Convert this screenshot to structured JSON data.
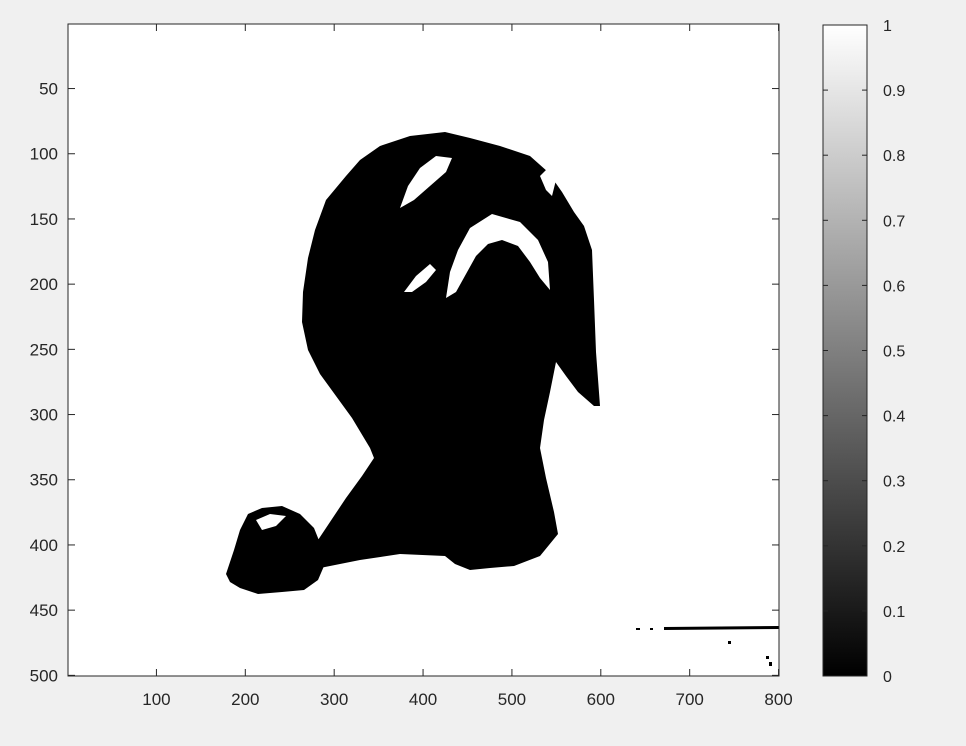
{
  "chart_data": {
    "type": "heatmap",
    "title": "",
    "xlabel": "",
    "ylabel": "",
    "xlim": [
      0.5,
      800.5
    ],
    "ylim": [
      0.5,
      500.5
    ],
    "y_direction": "reversed",
    "x_ticks": [
      100,
      200,
      300,
      400,
      500,
      600,
      700,
      800
    ],
    "y_ticks": [
      50,
      100,
      150,
      200,
      250,
      300,
      350,
      400,
      450,
      500
    ],
    "colormap": "gray",
    "colorbar": {
      "location": "right",
      "range": [
        0,
        1
      ],
      "ticks": [
        0,
        0.1,
        0.2,
        0.3,
        0.4,
        0.5,
        0.6,
        0.7,
        0.8,
        0.9,
        1
      ],
      "low_color": "#000000",
      "high_color": "#ffffff"
    },
    "grid": false,
    "content": "binary image: white background with a black silhouette of a dog"
  },
  "colors": {
    "figure_background": "#f0f0f0",
    "axes_background": "#ffffff",
    "axis_color": "#262626",
    "foreground_value": "#000000"
  }
}
